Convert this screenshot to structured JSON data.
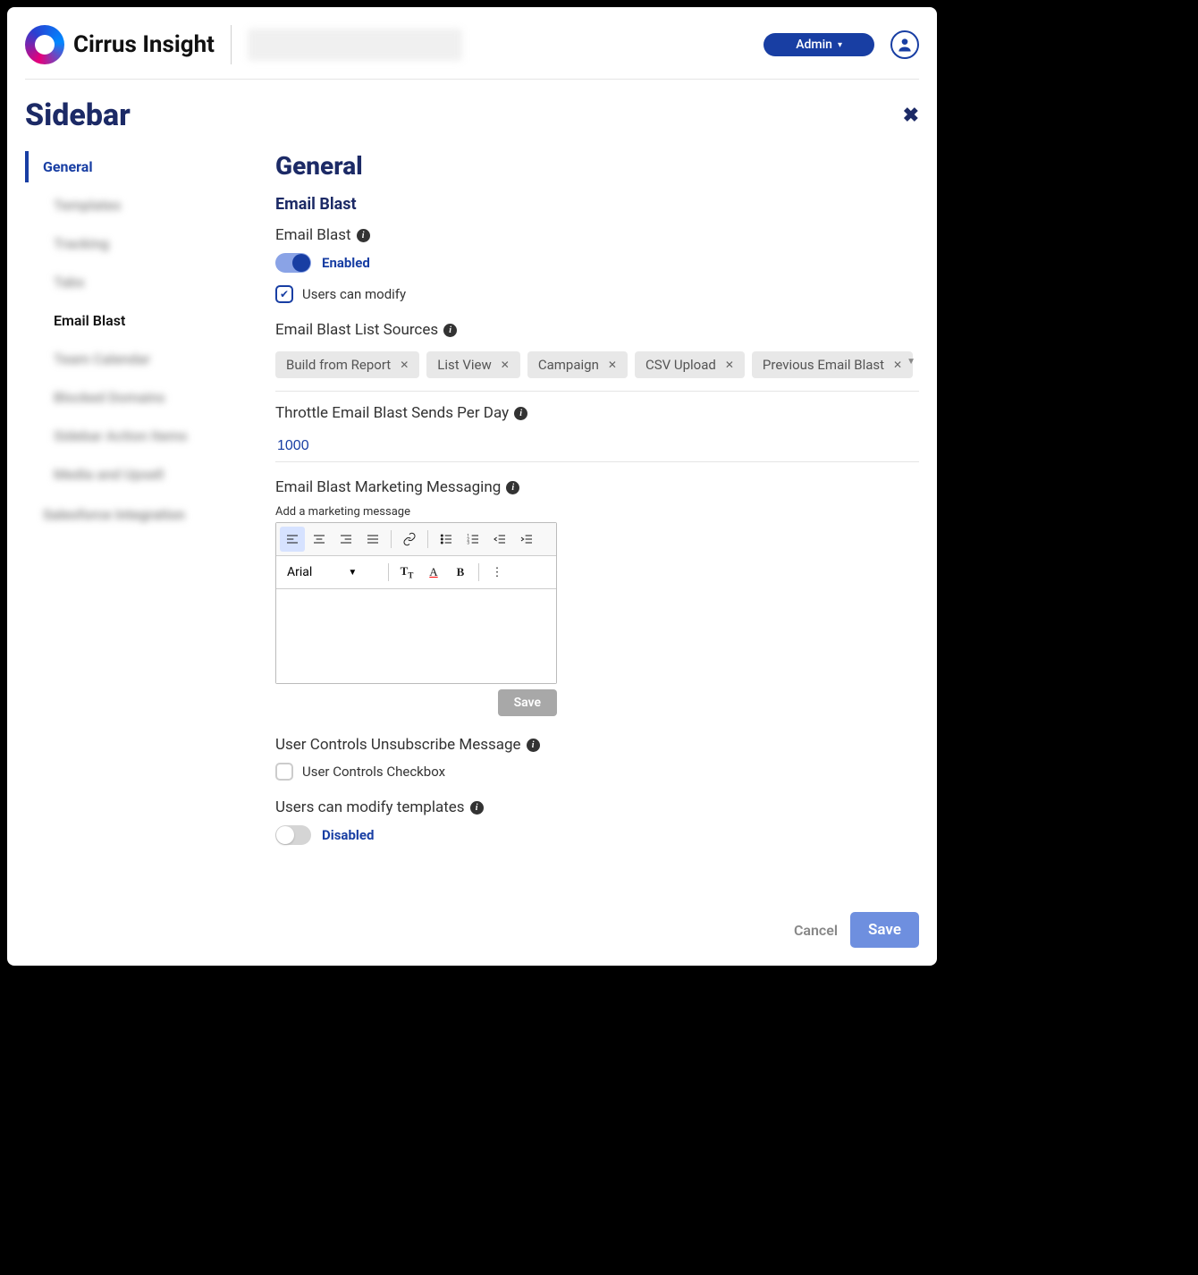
{
  "header": {
    "brand": "Cirrus Insight",
    "admin_label": "Admin"
  },
  "page": {
    "title": "Sidebar"
  },
  "sidebar": {
    "items": [
      {
        "label": "General",
        "active": true,
        "blur": false,
        "sub": false
      },
      {
        "label": "Templates",
        "active": false,
        "blur": true,
        "sub": true
      },
      {
        "label": "Tracking",
        "active": false,
        "blur": true,
        "sub": true
      },
      {
        "label": "Tabs",
        "active": false,
        "blur": true,
        "sub": true
      },
      {
        "label": "Email Blast",
        "active": true,
        "blur": false,
        "sub": true
      },
      {
        "label": "Team Calendar",
        "active": false,
        "blur": true,
        "sub": true
      },
      {
        "label": "Blocked Domains",
        "active": false,
        "blur": true,
        "sub": true
      },
      {
        "label": "Sidebar Action Items",
        "active": false,
        "blur": true,
        "sub": true
      },
      {
        "label": "Media and Upsell",
        "active": false,
        "blur": true,
        "sub": true
      },
      {
        "label": "Salesforce Integration",
        "active": false,
        "blur": true,
        "sub": false
      }
    ]
  },
  "main": {
    "heading": "General",
    "subheading": "Email Blast",
    "email_blast": {
      "label": "Email Blast",
      "toggle_state": "Enabled",
      "checkbox_label": "Users can modify",
      "checkbox_checked": true
    },
    "list_sources": {
      "label": "Email Blast List Sources",
      "chips": [
        "Build from Report",
        "List View",
        "Campaign",
        "CSV Upload",
        "Previous Email Blast"
      ]
    },
    "throttle": {
      "label": "Throttle Email Blast Sends Per Day",
      "value": "1000"
    },
    "marketing": {
      "label": "Email Blast Marketing Messaging",
      "sub_label": "Add a marketing message",
      "font": "Arial",
      "save_label": "Save"
    },
    "unsubscribe": {
      "label": "User Controls Unsubscribe Message",
      "checkbox_label": "User Controls Checkbox",
      "checkbox_checked": false
    },
    "modify_templates": {
      "label": "Users can modify templates",
      "toggle_state": "Disabled"
    }
  },
  "footer": {
    "cancel": "Cancel",
    "save": "Save"
  }
}
